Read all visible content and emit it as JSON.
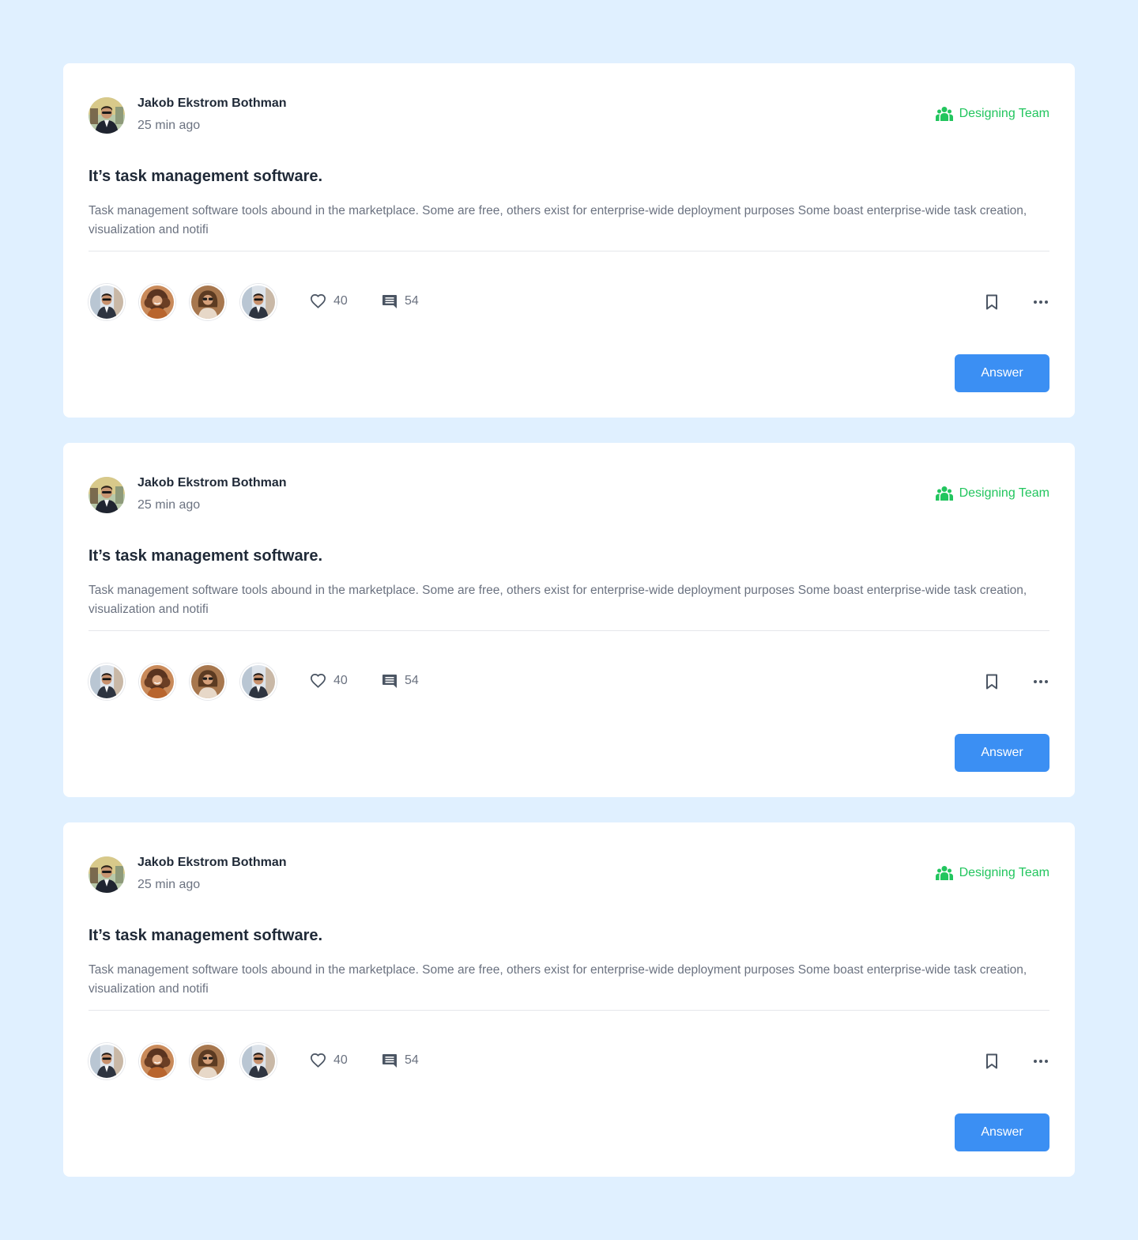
{
  "colors": {
    "background": "#E0F0FF",
    "card": "#FFFFFF",
    "accent_blue": "#3B8FF3",
    "team_green": "#22C55E",
    "text_dark": "#1F2937",
    "text_muted": "#6B7280"
  },
  "posts": [
    {
      "author": "Jakob Ekstrom Bothman",
      "time": "25 min ago",
      "team": "Designing Team",
      "team_icon": "team-icon",
      "title": "It’s task management software.",
      "body": "Task management software tools abound in the marketplace. Some are free, others exist for enterprise-wide deployment purposes Some boast enterprise-wide task creation, visualization and notifi",
      "likes": "40",
      "comments": "54",
      "participants": [
        "man-suit-avatar",
        "woman-curly-avatar",
        "woman-sunglasses-avatar",
        "man-suit-avatar"
      ],
      "answer_label": "Answer"
    },
    {
      "author": "Jakob Ekstrom Bothman",
      "time": "25 min ago",
      "team": "Designing Team",
      "team_icon": "team-icon",
      "title": "It’s task management software.",
      "body": "Task management software tools abound in the marketplace. Some are free, others exist for enterprise-wide deployment purposes Some boast enterprise-wide task creation, visualization and notifi",
      "likes": "40",
      "comments": "54",
      "participants": [
        "man-suit-avatar",
        "woman-curly-avatar",
        "woman-sunglasses-avatar",
        "man-suit-avatar"
      ],
      "answer_label": "Answer"
    },
    {
      "author": "Jakob Ekstrom Bothman",
      "time": "25 min ago",
      "team": "Designing Team",
      "team_icon": "team-icon",
      "title": "It’s task management software.",
      "body": "Task management software tools abound in the marketplace. Some are free, others exist for enterprise-wide deployment purposes Some boast enterprise-wide task creation, visualization and notifi",
      "likes": "40",
      "comments": "54",
      "participants": [
        "man-suit-avatar",
        "woman-curly-avatar",
        "woman-sunglasses-avatar",
        "man-suit-avatar"
      ],
      "answer_label": "Answer"
    }
  ]
}
